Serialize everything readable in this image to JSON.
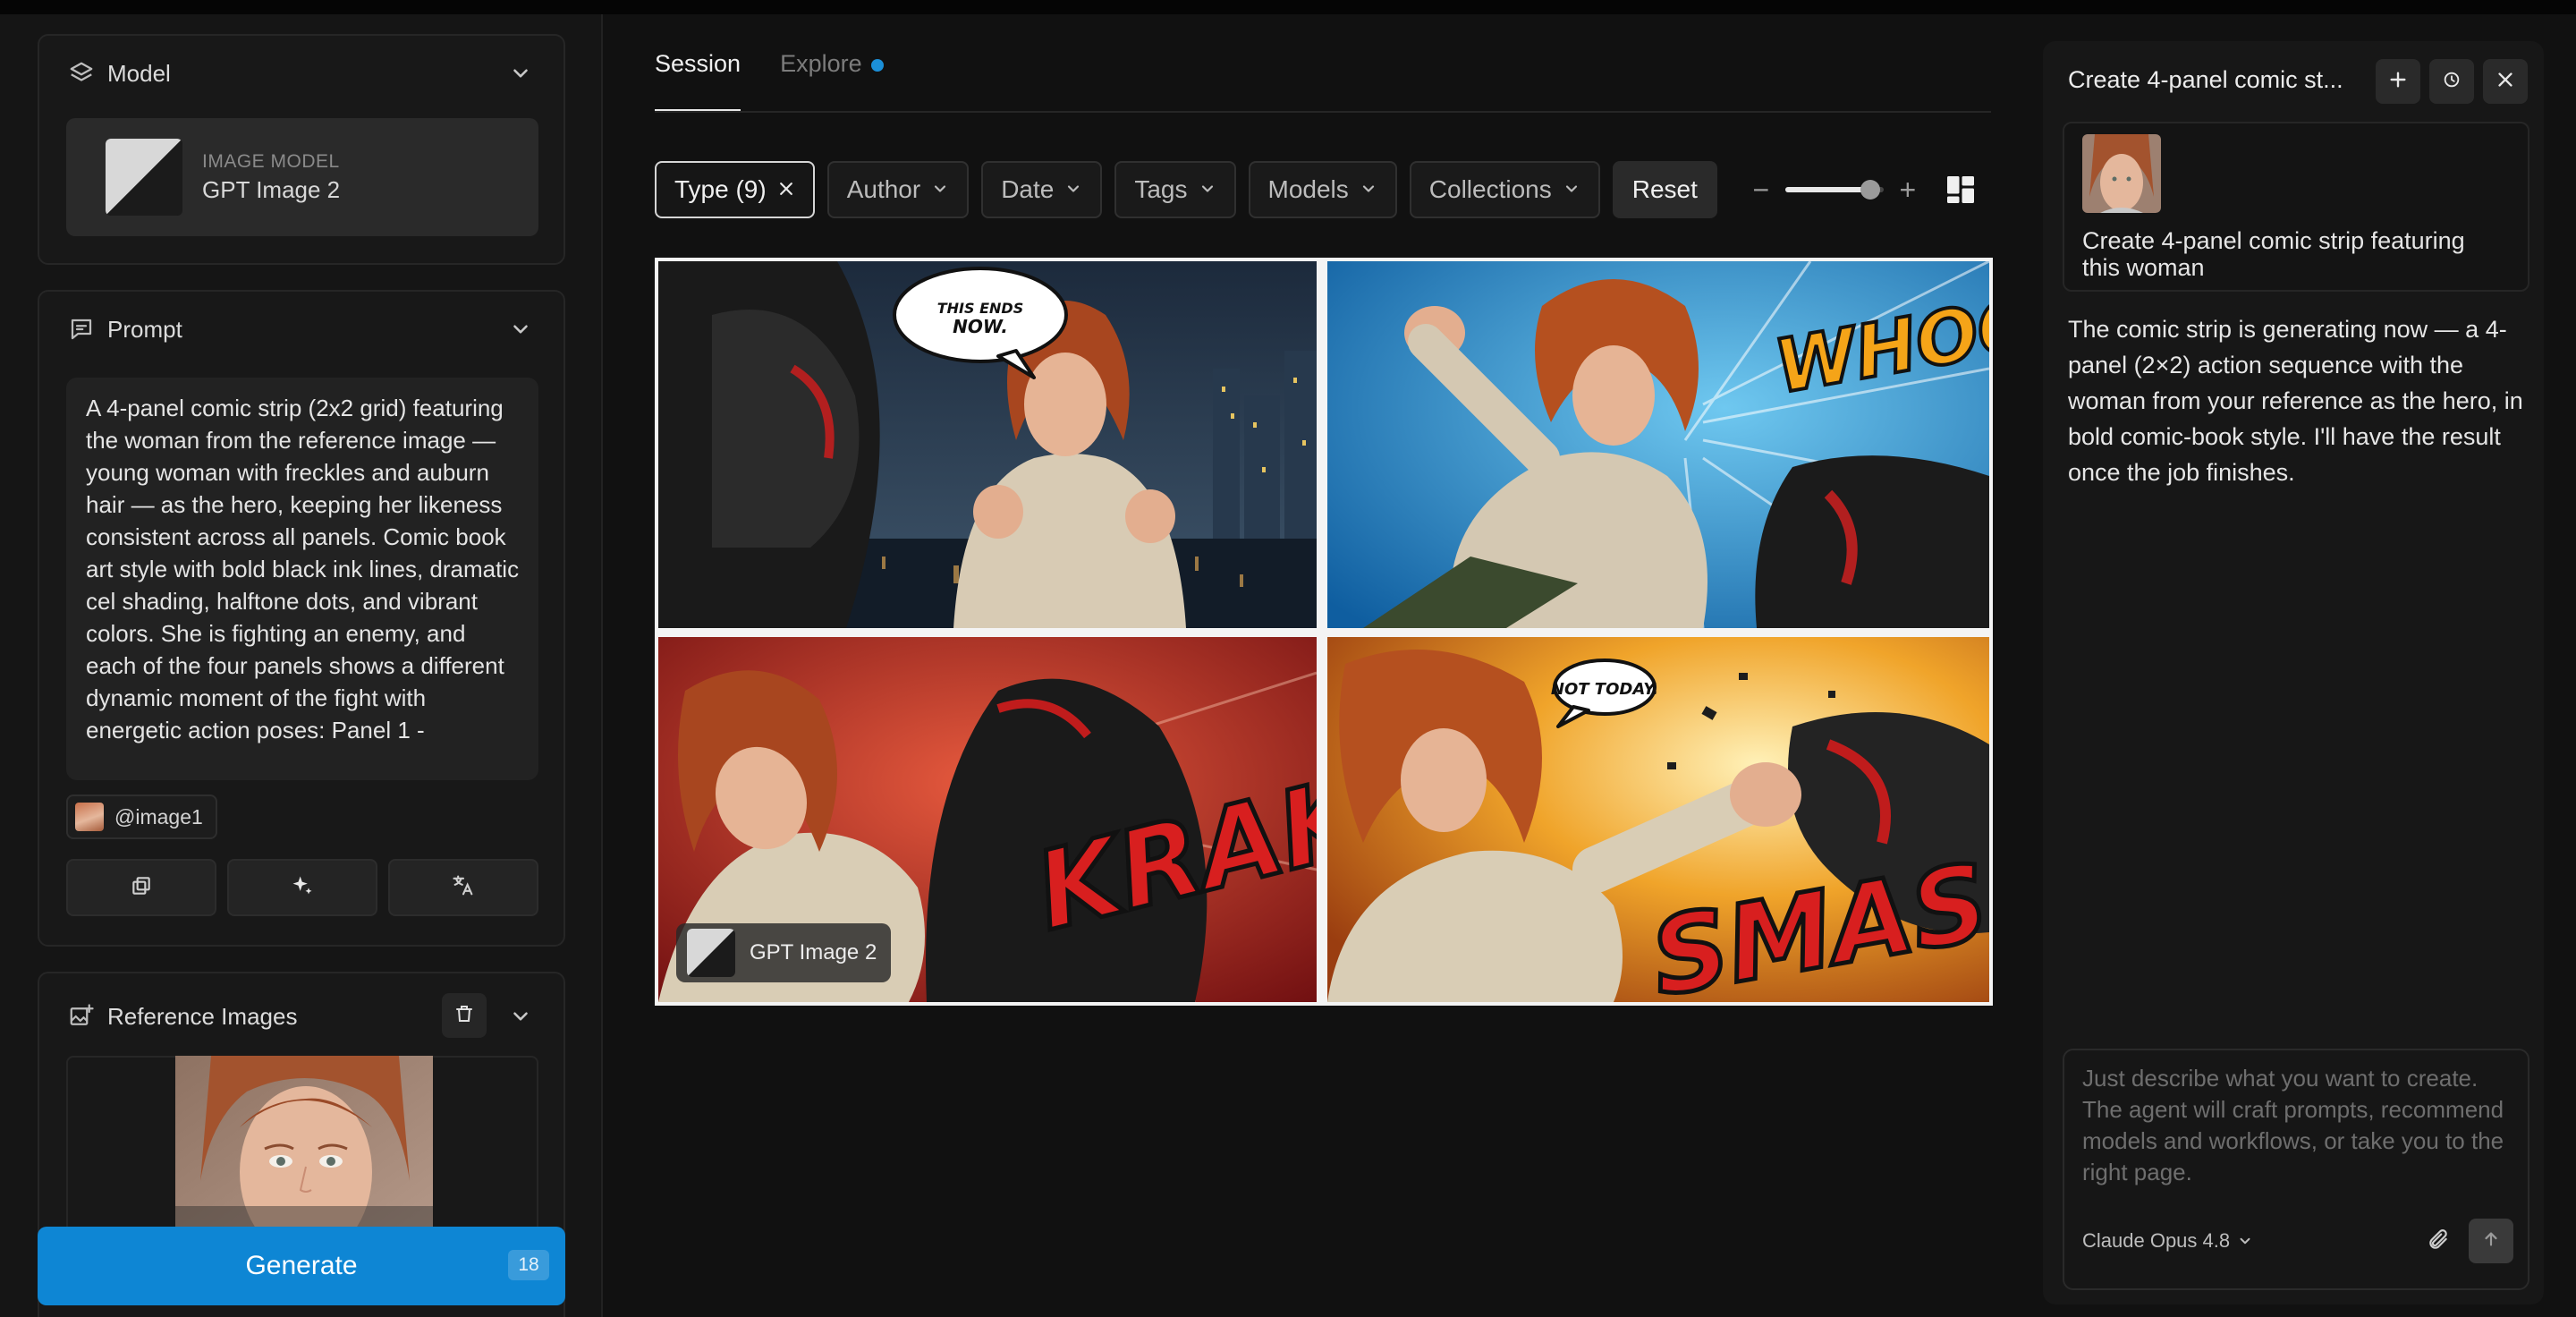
{
  "sidebar": {
    "model": {
      "title": "Model",
      "caption": "IMAGE MODEL",
      "name": "GPT Image 2"
    },
    "prompt": {
      "title": "Prompt",
      "text": "A 4-panel comic strip (2x2 grid) featuring the woman from the reference image — young woman with freckles and auburn hair — as the hero, keeping her likeness consistent across all panels. Comic book art style with bold black ink lines, dramatic cel shading, halftone dots, and vibrant colors. She is fighting an enemy, and each of the four panels shows a different dynamic moment of the fight with energetic action poses: Panel 1 -",
      "chip": "@image1"
    },
    "reference": {
      "title": "Reference Images"
    },
    "generate": {
      "label": "Generate",
      "badge": "18"
    }
  },
  "main": {
    "tabs": [
      {
        "label": "Session"
      },
      {
        "label": "Explore"
      }
    ],
    "filters": {
      "type": "Type (9)",
      "author": "Author",
      "date": "Date",
      "tags": "Tags",
      "models": "Models",
      "collections": "Collections",
      "reset": "Reset"
    },
    "zoom_level": 0.8,
    "result": {
      "model_tag": "GPT Image 2",
      "panels": [
        {
          "speech": "THIS ENDS NOW."
        },
        {
          "sfx": "WHOOOSH!"
        },
        {
          "sfx": "KRAK!"
        },
        {
          "speech": "NOT TODAY.",
          "sfx": "SMASH!"
        }
      ]
    }
  },
  "chat": {
    "title": "Create 4-panel comic st...",
    "user_message": "Create 4-panel comic strip featuring this woman",
    "reply": "The comic strip is generating now — a 4-panel (2×2) action sequence with the woman from your reference as the hero, in bold comic-book style. I'll have the result once the job finishes.",
    "placeholder": "Just describe what you want to create. The agent will craft prompts, recommend models and workflows, or take you to the right page.",
    "model": "Claude Opus 4.8"
  },
  "colors": {
    "accent": "#0e86d4",
    "background": "#111111"
  }
}
